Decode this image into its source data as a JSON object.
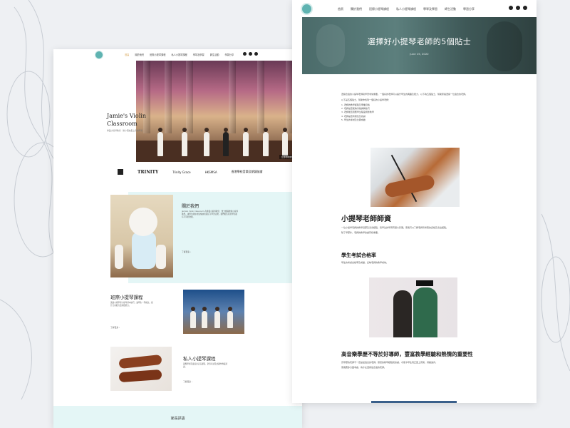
{
  "left_page": {
    "nav": {
      "items": [
        "首頁",
        "關於我們",
        "班際小提琴課程",
        "私人小提琴課程",
        "學琴及學習",
        "師生活動",
        "學習分享"
      ],
      "active_index": 0
    },
    "hero": {
      "title": "Jamie's Violin Classroom",
      "subtitle": "專業小提琴教室 · 助小朋友愛上音樂學習",
      "button": "立即預約試堂 ›"
    },
    "logos": [
      "TRINITY",
      "Trinity Grace",
      "HKSMSA",
      "香港學校音樂及朗誦協會"
    ],
    "about": {
      "heading": "關於我們",
      "text": "Jamie's Violin Classroom 為專業小提琴教室，致力推廣優質小提琴教學，讓學生能在輕鬆愉快的環境下學習音樂。我們相信每位學生都有不同的潛能。",
      "more": "了解更多 ›"
    },
    "group_course": {
      "heading": "班際小提琴課程",
      "text": "透過小組學習小提琴基本技巧，讓學生一同成長，提升合奏能力及聆聽能力。",
      "more": "了解更多 ›"
    },
    "private_course": {
      "heading": "私人小提琴課程",
      "text": "因應學生程度度身訂造課程，針對考試及比賽作專業培訓。",
      "more": "了解更多 ›"
    },
    "reviews_heading": "家長評語"
  },
  "right_page": {
    "nav": {
      "items": [
        "首頁",
        "關於我們",
        "班際小提琴課程",
        "私人小提琴課程",
        "學琴及學習",
        "師生活動",
        "學習分享"
      ]
    },
    "article": {
      "title": "選擇好小提琴老師的5個貼士",
      "date": "June 15, 2022",
      "intro": "選擇合適的小提琴老師對學習非常重要。一個好的老師可以提升學生的興趣及能力，以下為五個貼士，幫助家長選擇一位適合的老師。",
      "intro2": "以下是五個貼士，幫助你找到一個好的小提琴老師：",
      "tips": [
        "1. 老師的教學經驗及專業資格",
        "2. 老師是否能夠清楚講解技巧",
        "3. 老師能否因應學生程度調整教學",
        "4. 老師是否有耐性及熱誠",
        "5. 學生的考試及比賽成績"
      ],
      "section1_heading": "小提琴老師師資",
      "section1_text": "一位小提琴老師的教學資歷及演奏經驗，對學生的學習有很大影響。家長可以了解老師曾考取的資格及演出經驗。",
      "section1_text2": "除了學歷外，老師的教學熱誠同樣重要。",
      "section2_heading": "學生考試合格率",
      "section2_text": "學生的考試合格率及成績，反映老師的教學成效。",
      "section3_heading": "高音樂學歷不等於好導師，豐富教學經驗和熱情的重要性",
      "section3_text": "高學歷的老師不一定是最適合的老師。豐富的教學經驗和熱誠，才能令學生真正愛上音樂，持續進步。",
      "section3_text2": "家長應多方面考慮，為子女選擇最合適的老師。"
    }
  },
  "colors": {
    "accent_teal": "#5fb3b1",
    "accent_light": "#e4f6f6",
    "nav_active": "#d6a04e"
  }
}
